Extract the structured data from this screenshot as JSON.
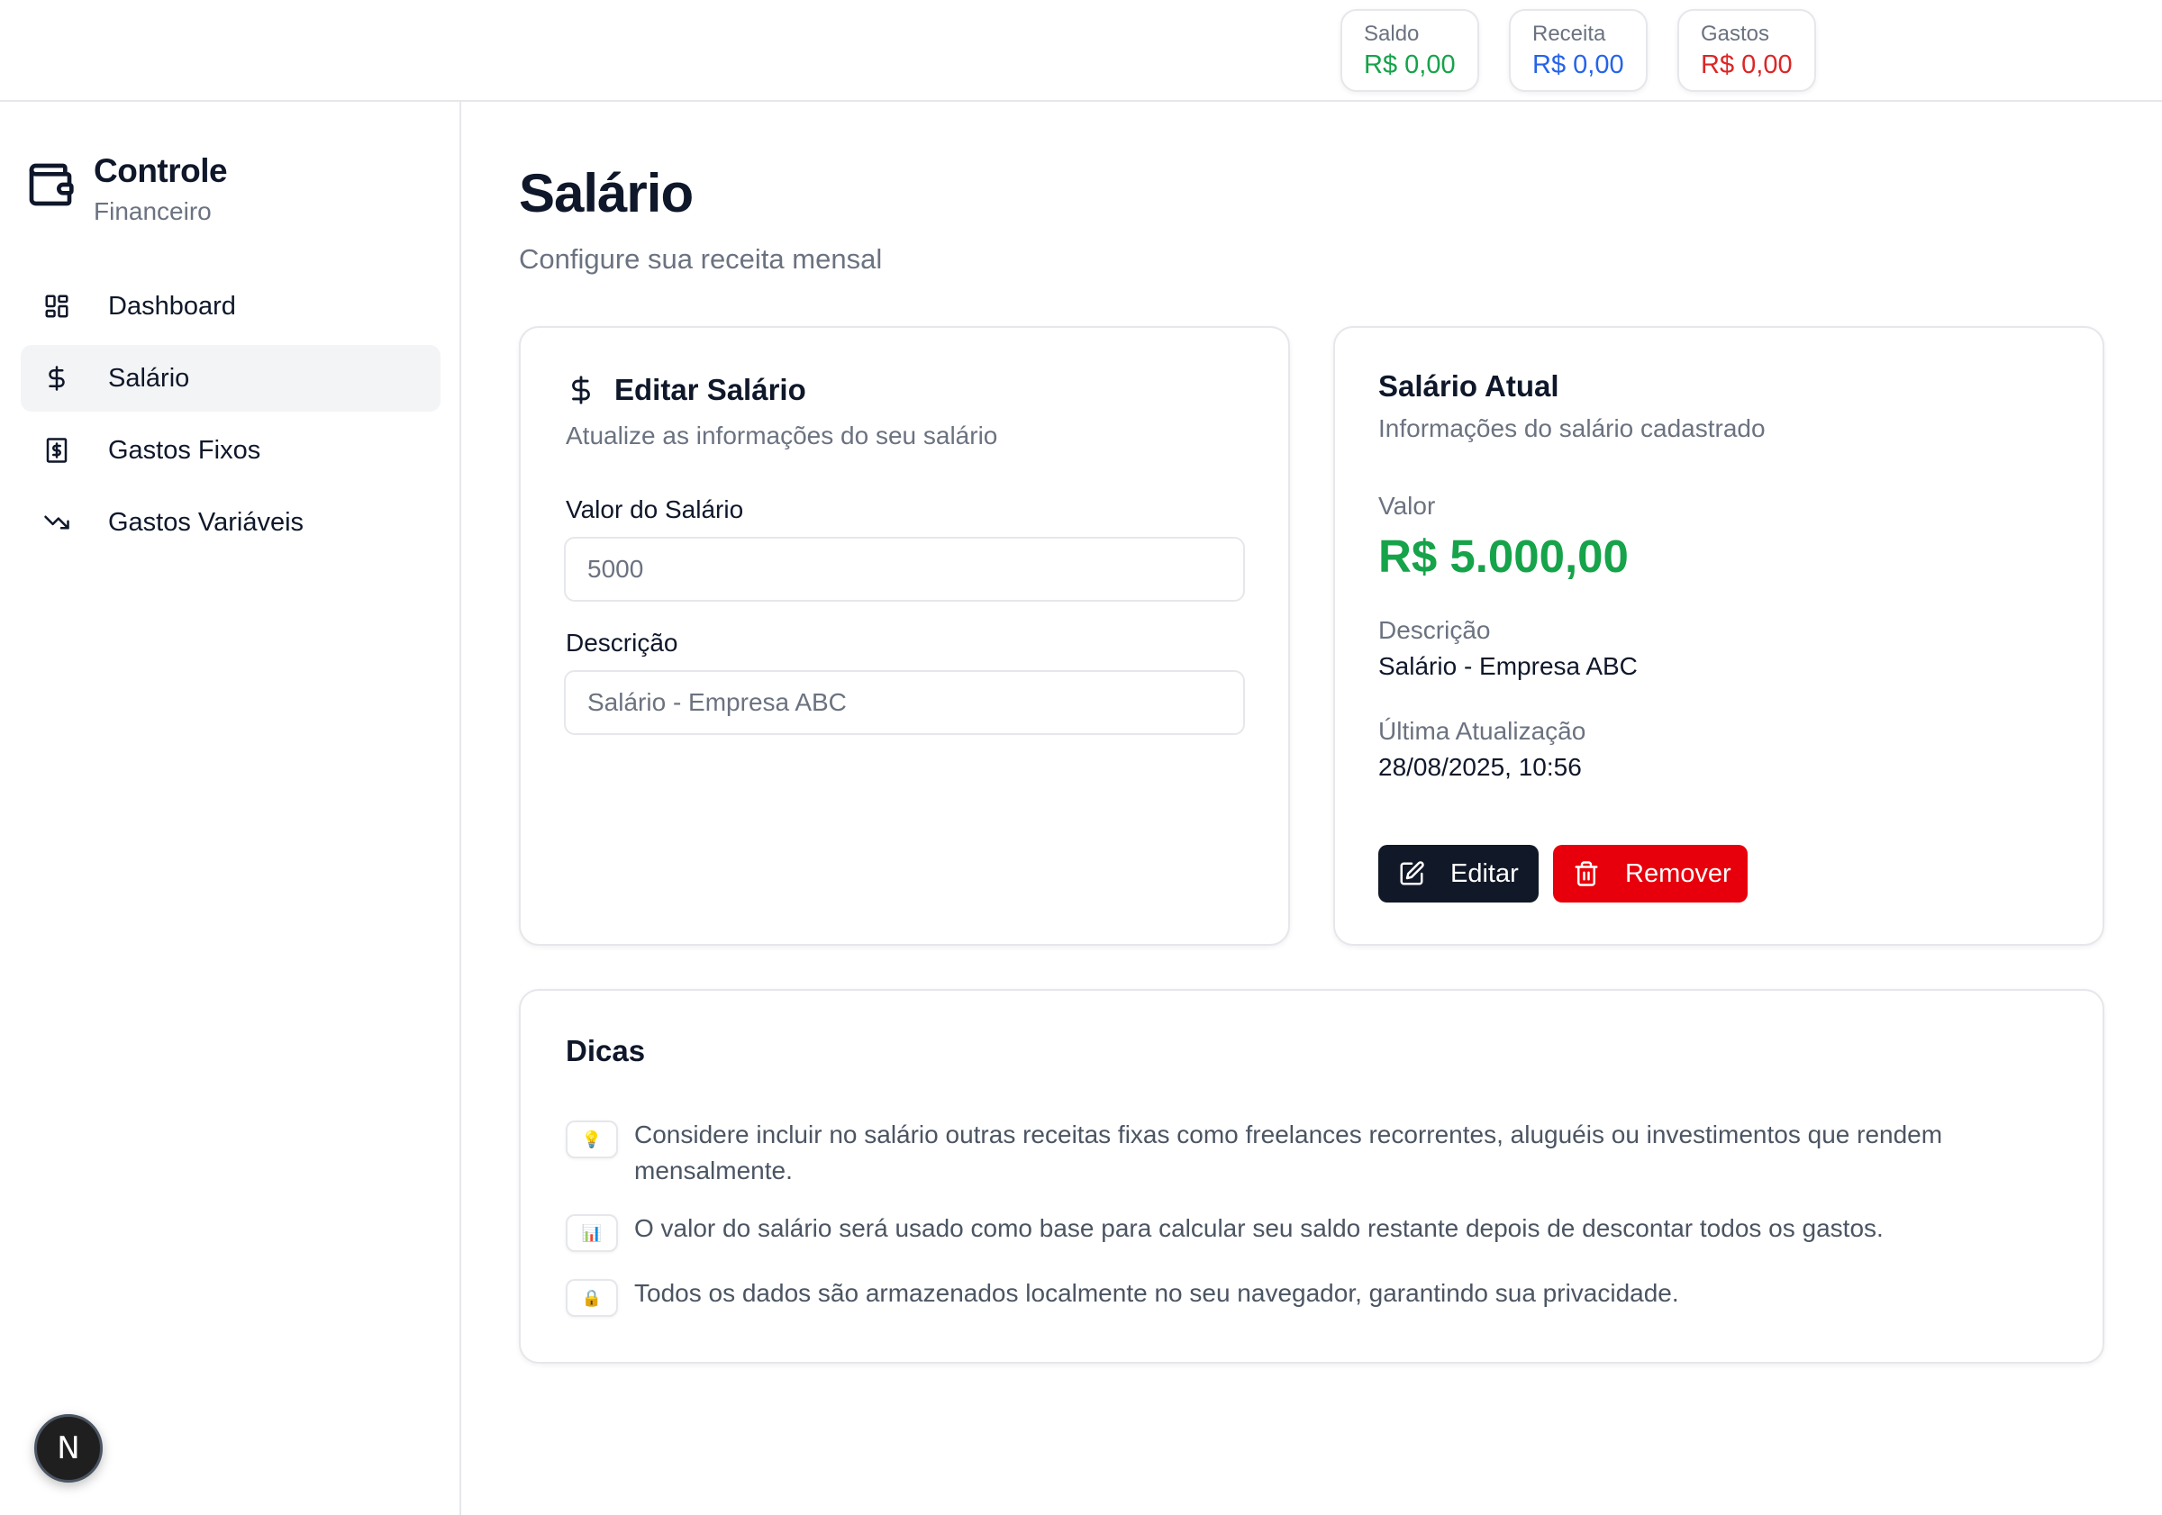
{
  "topbar": {
    "stats": [
      {
        "label": "Saldo",
        "value": "R$ 0,00",
        "color": "#16a34a"
      },
      {
        "label": "Receita",
        "value": "R$ 0,00",
        "color": "#2563eb"
      },
      {
        "label": "Gastos",
        "value": "R$ 0,00",
        "color": "#dc2626"
      }
    ]
  },
  "sidebar": {
    "brand_title": "Controle",
    "brand_subtitle": "Financeiro",
    "brand_icon": "wallet-icon",
    "items": [
      {
        "label": "Dashboard",
        "icon": "dashboard-icon"
      },
      {
        "label": "Salário",
        "icon": "dollar-icon",
        "active": true
      },
      {
        "label": "Gastos Fixos",
        "icon": "receipt-icon"
      },
      {
        "label": "Gastos Variáveis",
        "icon": "trending-down-icon"
      }
    ]
  },
  "main": {
    "title": "Salário",
    "subtitle": "Configure sua receita mensal"
  },
  "edit_card": {
    "title": "Editar Salário",
    "subtitle": "Atualize as informações do seu salário",
    "salary_label": "Valor do Salário",
    "salary_placeholder": "5000",
    "description_label": "Descrição",
    "description_placeholder": "Salário - Empresa ABC"
  },
  "current_card": {
    "title": "Salário Atual",
    "subtitle": "Informações do salário cadastrado",
    "value_label": "Valor",
    "value": "R$ 5.000,00",
    "value_color": "#16a34a",
    "description_label": "Descrição",
    "description": "Salário - Empresa ABC",
    "updated_label": "Última Atualização",
    "updated": "28/08/2025, 10:56",
    "edit_button": "Editar",
    "remove_button": "Remover"
  },
  "tips_card": {
    "title": "Dicas",
    "tips": [
      {
        "icon": "lightbulb-icon",
        "glyph": "💡",
        "text": "Considere incluir no salário outras receitas fixas como freelances recorrentes, aluguéis ou investimentos que rendem mensalmente."
      },
      {
        "icon": "bar-chart-icon",
        "glyph": "📊",
        "text": "O valor do salário será usado como base para calcular seu saldo restante depois de descontar todos os gastos."
      },
      {
        "icon": "lock-icon",
        "glyph": "🔒",
        "text": "Todos os dados são armazenados localmente no seu navegador, garantindo sua privacidade."
      }
    ]
  },
  "badge": {
    "letter": "N"
  }
}
